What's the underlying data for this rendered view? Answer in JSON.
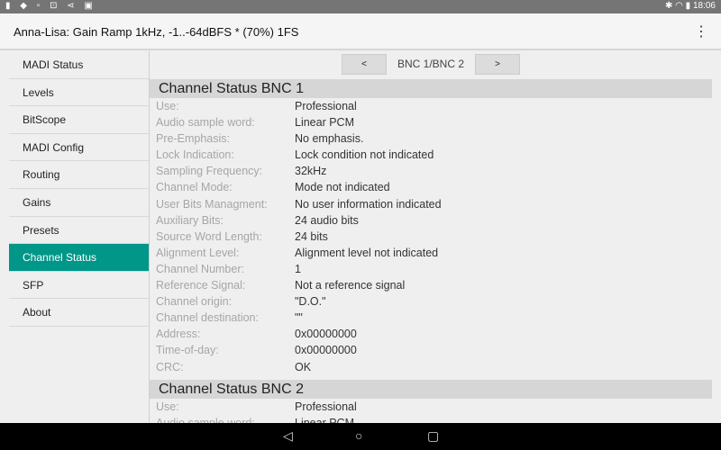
{
  "status_bar": {
    "icons": [
      "usb-icon",
      "dropbox-icon",
      "image-icon",
      "lock-icon",
      "share-icon",
      "photo-icon"
    ],
    "right_icons": [
      "bluetooth-icon",
      "wifi-icon",
      "battery-icon"
    ],
    "time": "18:06"
  },
  "app_bar": {
    "title": "Anna-Lisa: Gain Ramp 1kHz, -1..-64dBFS * (70%) 1FS",
    "menu_icon": "more-vert-icon"
  },
  "sidebar": {
    "items": [
      {
        "label": "MADI Status"
      },
      {
        "label": "Levels"
      },
      {
        "label": "BitScope"
      },
      {
        "label": "MADI Config"
      },
      {
        "label": "Routing"
      },
      {
        "label": "Gains"
      },
      {
        "label": "Presets"
      },
      {
        "label": "Channel Status",
        "selected": true
      },
      {
        "label": "SFP"
      },
      {
        "label": "About"
      }
    ],
    "accent": "#009688"
  },
  "nav": {
    "prev": "<",
    "label": "BNC 1/BNC 2",
    "next": ">"
  },
  "sections": [
    {
      "title": "Channel Status BNC 1",
      "rows": [
        {
          "k": "Use:",
          "v": "Professional"
        },
        {
          "k": "Audio sample word:",
          "v": "Linear PCM"
        },
        {
          "k": "Pre-Emphasis:",
          "v": "No emphasis."
        },
        {
          "k": "Lock Indication:",
          "v": "Lock condition not indicated"
        },
        {
          "k": "Sampling Frequency:",
          "v": "32kHz"
        },
        {
          "k": "Channel Mode:",
          "v": "Mode not indicated"
        },
        {
          "k": "User Bits Managment:",
          "v": "No user information indicated"
        },
        {
          "k": "Auxiliary Bits:",
          "v": "24 audio bits"
        },
        {
          "k": "Source Word Length:",
          "v": "24 bits"
        },
        {
          "k": "Alignment Level:",
          "v": "Alignment level not indicated"
        },
        {
          "k": "Channel Number:",
          "v": "1"
        },
        {
          "k": "Reference Signal:",
          "v": "Not a reference signal"
        },
        {
          "k": "Channel origin:",
          "v": "\"D.O.\""
        },
        {
          "k": "Channel destination:",
          "v": "\"\""
        },
        {
          "k": "Address:",
          "v": "0x00000000"
        },
        {
          "k": "Time-of-day:",
          "v": "0x00000000"
        },
        {
          "k": "CRC:",
          "v": "OK"
        }
      ]
    },
    {
      "title": "Channel Status BNC 2",
      "rows": [
        {
          "k": "Use:",
          "v": "Professional"
        },
        {
          "k": "Audio sample word:",
          "v": "Linear PCM"
        }
      ]
    }
  ]
}
